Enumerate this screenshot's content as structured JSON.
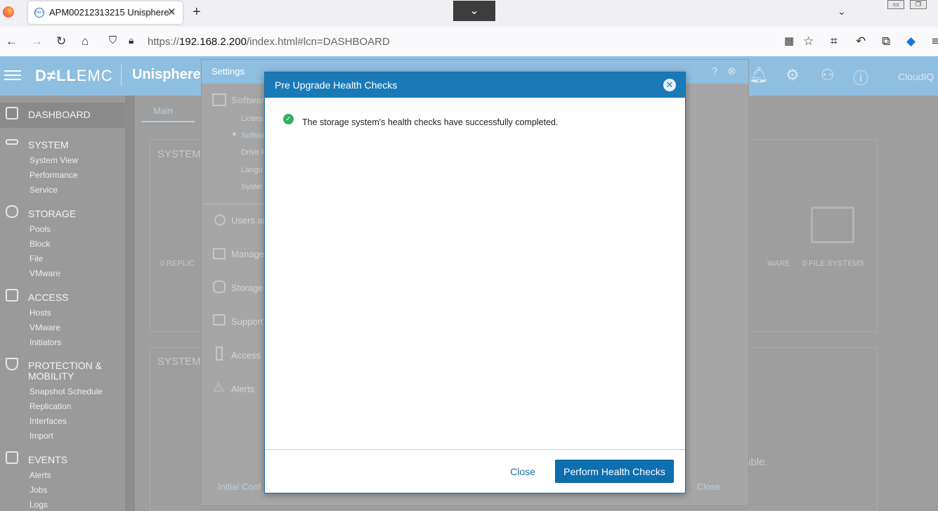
{
  "browser": {
    "tab_title": "APM00212313215 Unisphere",
    "favicon_text": "DELL",
    "url_scheme": "https://",
    "url_host": "192.168.2.200",
    "url_path": "/index.html#lcn=DASHBOARD"
  },
  "app": {
    "brand_dell": "D≠LL",
    "brand_emc": "EMC",
    "name": "Unisphere",
    "cloudiq": "CloudIQ"
  },
  "sidebar": {
    "dashboard": "DASHBOARD",
    "system": "SYSTEM",
    "system_items": [
      "System View",
      "Performance",
      "Service"
    ],
    "storage": "STORAGE",
    "storage_items": [
      "Pools",
      "Block",
      "File",
      "VMware"
    ],
    "access": "ACCESS",
    "access_items": [
      "Hosts",
      "VMware",
      "Initiators"
    ],
    "protection": "PROTECTION &",
    "protection2": "MOBILITY",
    "protection_items": [
      "Snapshot Schedule",
      "Replication",
      "Interfaces",
      "Import"
    ],
    "events": "EVENTS",
    "events_items": [
      "Alerts",
      "Jobs",
      "Logs"
    ]
  },
  "main": {
    "tab_main": "Main",
    "card1_title": "SYSTEM",
    "card2_title": "SYSTEM",
    "replic": "0   REPLIC",
    "ware": "WARE",
    "file_systems": "0   FILE SYSTEMS",
    "able": "able."
  },
  "settings": {
    "title": "Settings",
    "software": "Softwar",
    "sub": [
      "Licens",
      "Softwa",
      "Drive F",
      "Langu",
      "Syster"
    ],
    "menu": [
      "Users ar",
      "Manage",
      "Storage",
      "Support",
      "Access",
      "Alerts"
    ],
    "initial_config": "Initial Conf",
    "close": "Close"
  },
  "modal": {
    "title": "Pre Upgrade Health Checks",
    "message": "The storage system's health checks have successfully completed.",
    "close_label": "Close",
    "perform_label": "Perform Health Checks"
  }
}
